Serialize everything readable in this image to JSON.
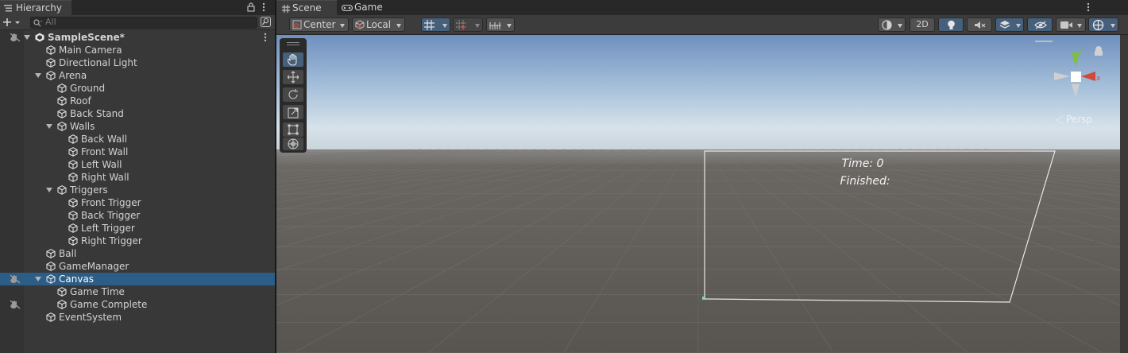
{
  "hierarchy": {
    "tab_label": "Hierarchy",
    "search_placeholder": "All",
    "items": [
      {
        "label": "SampleScene*",
        "depth": 0,
        "expanded": true,
        "type": "scene"
      },
      {
        "label": "Main Camera",
        "depth": 1
      },
      {
        "label": "Directional Light",
        "depth": 1
      },
      {
        "label": "Arena",
        "depth": 1,
        "expanded": true
      },
      {
        "label": "Ground",
        "depth": 2
      },
      {
        "label": "Roof",
        "depth": 2
      },
      {
        "label": "Back Stand",
        "depth": 2
      },
      {
        "label": "Walls",
        "depth": 2,
        "expanded": true
      },
      {
        "label": "Back Wall",
        "depth": 3
      },
      {
        "label": "Front Wall",
        "depth": 3
      },
      {
        "label": "Left Wall",
        "depth": 3
      },
      {
        "label": "Right Wall",
        "depth": 3
      },
      {
        "label": "Triggers",
        "depth": 2,
        "expanded": true
      },
      {
        "label": "Front Trigger",
        "depth": 3
      },
      {
        "label": "Back Trigger",
        "depth": 3
      },
      {
        "label": "Left Trigger",
        "depth": 3
      },
      {
        "label": "Right Trigger",
        "depth": 3
      },
      {
        "label": "Ball",
        "depth": 1
      },
      {
        "label": "GameManager",
        "depth": 1
      },
      {
        "label": "Canvas",
        "depth": 1,
        "expanded": true,
        "selected": true
      },
      {
        "label": "Game Time",
        "depth": 2
      },
      {
        "label": "Game Complete",
        "depth": 2
      },
      {
        "label": "EventSystem",
        "depth": 1
      }
    ]
  },
  "scene": {
    "tabs": [
      "Scene",
      "Game"
    ],
    "toolbar": {
      "pivot_label": "Center",
      "space_label": "Local",
      "two_d_label": "2D"
    },
    "gizmo": {
      "projection_label": "Persp",
      "x_label": "x",
      "y_label": "y"
    },
    "canvas_texts": {
      "time": "Time: 0",
      "finished": "Finished:"
    }
  },
  "colors": {
    "selection": "#2c5d87",
    "sky_top": "#6f90bf",
    "ground": "#585450",
    "accent_active": "#46607c"
  }
}
